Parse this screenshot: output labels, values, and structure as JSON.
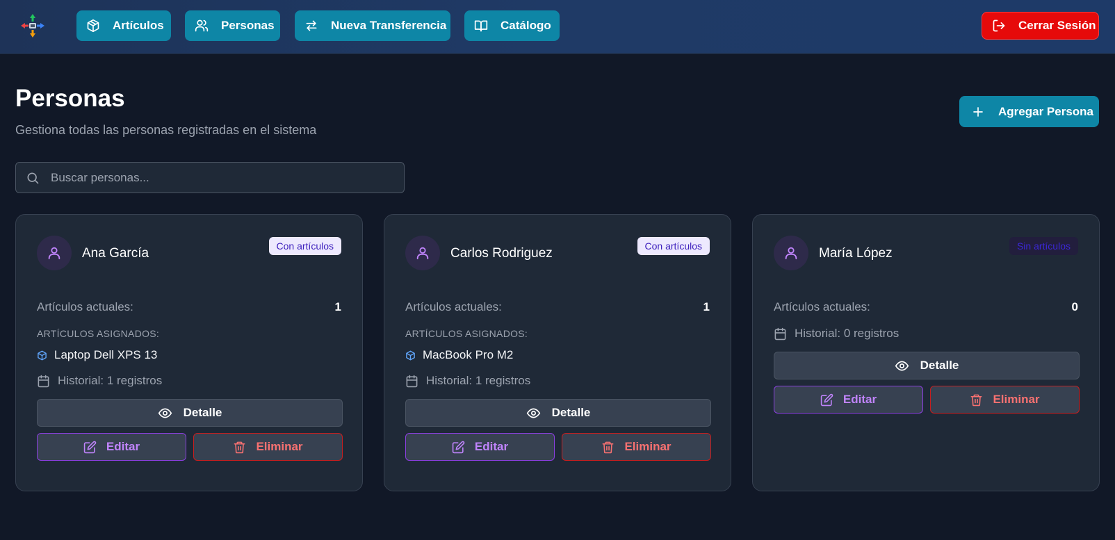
{
  "nav": {
    "logo_icon": "move-arrows-icon",
    "items": [
      {
        "label": "Artículos",
        "icon": "box-icon"
      },
      {
        "label": "Personas",
        "icon": "users-icon"
      },
      {
        "label": "Nueva Transferencia",
        "icon": "transfer-icon"
      },
      {
        "label": "Catálogo",
        "icon": "book-icon"
      }
    ],
    "logout_label": "Cerrar Sesión"
  },
  "header": {
    "title": "Personas",
    "subtitle": "Gestiona todas las personas registradas en el sistema",
    "add_label": "Agregar Persona"
  },
  "search": {
    "placeholder": "Buscar personas...",
    "value": ""
  },
  "people": [
    {
      "name": "Ana García",
      "badge": "Con artículos",
      "articles_label": "Artículos actuales:",
      "articles_count": "1",
      "assigned_heading": "ARTÍCULOS ASIGNADOS:",
      "assigned_items": [
        "Laptop Dell XPS 13"
      ],
      "history": "Historial: 1 registros",
      "detail_label": "Detalle",
      "edit_label": "Editar",
      "delete_label": "Eliminar"
    },
    {
      "name": "Carlos Rodriguez",
      "badge": "Con artículos",
      "articles_label": "Artículos actuales:",
      "articles_count": "1",
      "assigned_heading": "ARTÍCULOS ASIGNADOS:",
      "assigned_items": [
        "MacBook Pro M2"
      ],
      "history": "Historial: 1 registros",
      "detail_label": "Detalle",
      "edit_label": "Editar",
      "delete_label": "Eliminar"
    },
    {
      "name": "María López",
      "badge": "Sin artículos",
      "articles_label": "Artículos actuales:",
      "articles_count": "0",
      "history": "Historial: 0 registros",
      "detail_label": "Detalle",
      "edit_label": "Editar",
      "delete_label": "Eliminar"
    }
  ],
  "colors": {
    "background": "#111827",
    "navbar": "#1e3a66",
    "primary": "#0e86a6",
    "danger": "#e60a0a",
    "card": "#1f2937",
    "edit": "#c084fc",
    "delete": "#f87171"
  }
}
